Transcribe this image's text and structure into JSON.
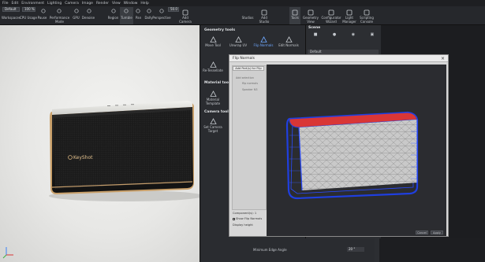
{
  "menubar": {
    "items": [
      "File",
      "Edit",
      "Environment",
      "Lighting",
      "Camera",
      "Image",
      "Render",
      "View",
      "Window",
      "Help"
    ]
  },
  "toolbar": {
    "preset_value": "Default",
    "zoom_value": "100 %",
    "buttons": [
      {
        "label": "Workspaces",
        "icon": "workspaces-icon",
        "active": false,
        "dim": false
      },
      {
        "label": "CPU Usage",
        "icon": "cpu-usage-icon",
        "active": false,
        "dim": false
      },
      {
        "label": "Pause",
        "icon": "pause-icon",
        "active": false,
        "dim": false
      },
      {
        "label": "Performance\nMode",
        "icon": "performance-mode-icon",
        "active": false,
        "dim": false
      },
      {
        "label": "GPU",
        "icon": "gpu-icon",
        "active": false,
        "dim": false
      },
      {
        "label": "Denoise",
        "icon": "denoise-icon",
        "active": false,
        "dim": false
      },
      {
        "label": "Region",
        "icon": "region-icon",
        "active": false,
        "dim": false
      },
      {
        "label": "Tumble",
        "icon": "tumble-icon",
        "active": true,
        "dim": false
      },
      {
        "label": "Pan",
        "icon": "pan-icon",
        "active": false,
        "dim": false
      },
      {
        "label": "Dolly",
        "icon": "dolly-icon",
        "active": false,
        "dim": false
      },
      {
        "label": "Perspective",
        "icon": "perspective-icon",
        "active": false,
        "dim": false
      },
      {
        "label": "Add\nCamera",
        "icon": "add-camera-icon",
        "active": false,
        "dim": false
      },
      {
        "label": "Studios",
        "icon": "studios-icon",
        "active": false,
        "dim": false
      },
      {
        "label": "Add\nStudio",
        "icon": "add-studio-icon",
        "active": false,
        "dim": false
      },
      {
        "label": "Tools",
        "icon": "tools-icon",
        "active": true,
        "dim": false
      },
      {
        "label": "Geometry\nView",
        "icon": "geometry-view-icon",
        "active": false,
        "dim": false
      },
      {
        "label": "Configurator\nWizard",
        "icon": "configurator-wizard-icon",
        "active": false,
        "dim": false
      },
      {
        "label": "Light\nManager",
        "icon": "light-manager-icon",
        "active": false,
        "dim": false
      },
      {
        "label": "Scripting\nConsole",
        "icon": "scripting-console-icon",
        "active": false,
        "dim": false
      }
    ],
    "speed_value": "50.0"
  },
  "viewport": {
    "product_logo_text": "KeyShot"
  },
  "tools_panel": {
    "geometry_header": "Geometry tools",
    "material_header": "Material tools",
    "camera_header": "Camera tools",
    "tools": [
      {
        "label": "Move Tool",
        "icon": "move-tool-icon",
        "selected": false
      },
      {
        "label": "Unwrap UV",
        "icon": "unwrap-uv-icon",
        "selected": false
      },
      {
        "label": "Flip Normals",
        "icon": "flip-normals-icon",
        "selected": true
      },
      {
        "label": "Edit Normals",
        "icon": "edit-normals-icon",
        "selected": false
      },
      {
        "label": "Re-Tessellate",
        "icon": "re-tessellate-icon",
        "selected": false
      },
      {
        "label": "Material\nTemplate",
        "icon": "material-template-icon",
        "selected": false
      },
      {
        "label": "Set Camera\nTarget",
        "icon": "set-camera-target-icon",
        "selected": false
      }
    ]
  },
  "scene_panel": {
    "title": "Scene",
    "default_row": "Default"
  },
  "dialog": {
    "title": "Flip Normals",
    "add_button": "Add Part(s) for Flip",
    "list_items": [
      "Add selection",
      "flip normals",
      "Speaker N3"
    ],
    "components_label": "Component(s): 1",
    "show_flip_label": "Show Flip Normals",
    "display_height_label": "Display height",
    "cancel_label": "Cancel",
    "ok_label": "Apply"
  },
  "props": {
    "min_edge_label": "Minimum Edge Angle",
    "min_edge_value": "20 °"
  },
  "colors": {
    "accent": "#3b82f6",
    "flip_red": "#d93636",
    "flip_blue": "#1f3fe0"
  }
}
